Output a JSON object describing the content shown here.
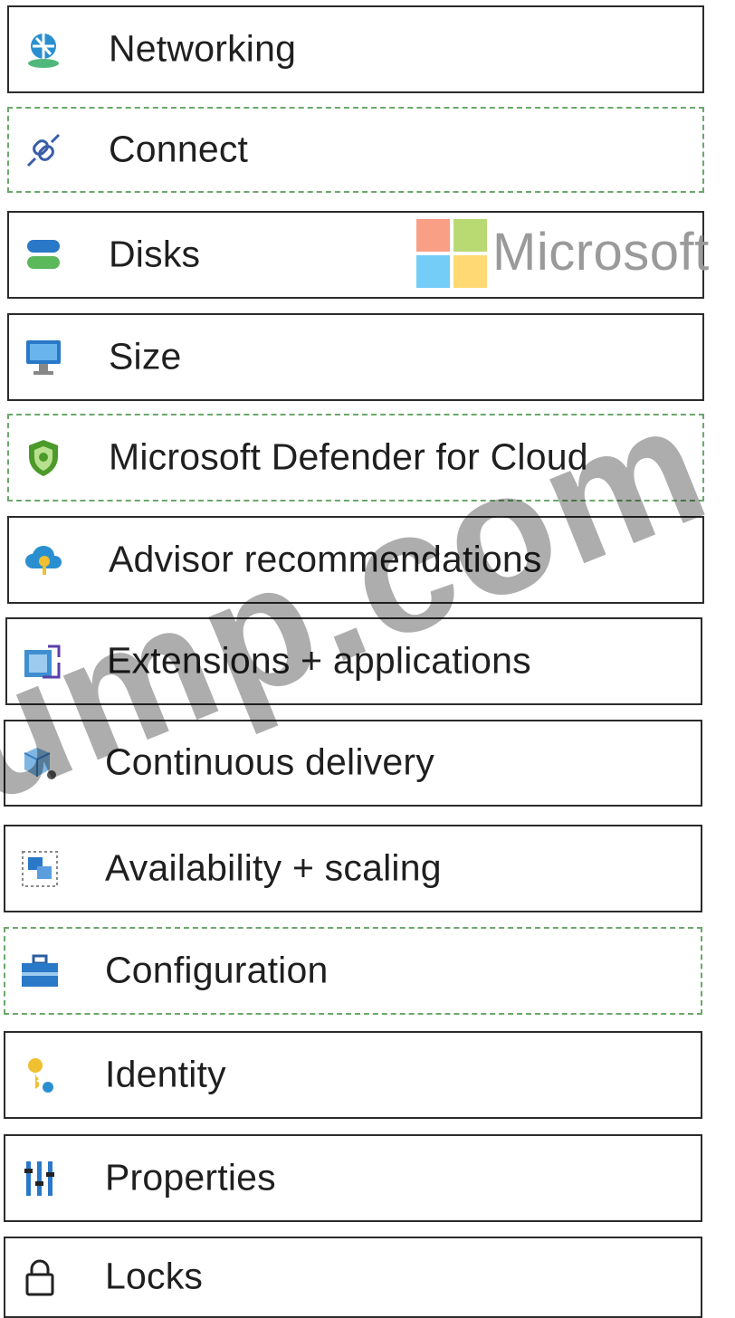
{
  "menu": {
    "items": [
      {
        "label": "Networking",
        "icon": "networking-icon",
        "highlighted": false
      },
      {
        "label": "Connect",
        "icon": "connect-icon",
        "highlighted": true
      },
      {
        "label": "Disks",
        "icon": "disks-icon",
        "highlighted": false
      },
      {
        "label": "Size",
        "icon": "size-icon",
        "highlighted": false
      },
      {
        "label": "Microsoft Defender for Cloud",
        "icon": "shield-icon",
        "highlighted": true
      },
      {
        "label": "Advisor recommendations",
        "icon": "advisor-cloud-icon",
        "highlighted": false
      },
      {
        "label": "Extensions + applications",
        "icon": "extensions-icon",
        "highlighted": false
      },
      {
        "label": "Continuous delivery",
        "icon": "continuous-delivery-icon",
        "highlighted": false
      },
      {
        "label": "Availability + scaling",
        "icon": "availability-icon",
        "highlighted": false
      },
      {
        "label": "Configuration",
        "icon": "toolbox-icon",
        "highlighted": true
      },
      {
        "label": "Identity",
        "icon": "identity-icon",
        "highlighted": false
      },
      {
        "label": "Properties",
        "icon": "properties-icon",
        "highlighted": false
      },
      {
        "label": "Locks",
        "icon": "lock-icon",
        "highlighted": false
      }
    ]
  },
  "watermark": {
    "brand_text": "Microsoft",
    "site_text": "ump.com"
  },
  "colors": {
    "border": "#2b2b2b",
    "highlight_border": "#6aa86a",
    "text": "#1f1f1f"
  }
}
